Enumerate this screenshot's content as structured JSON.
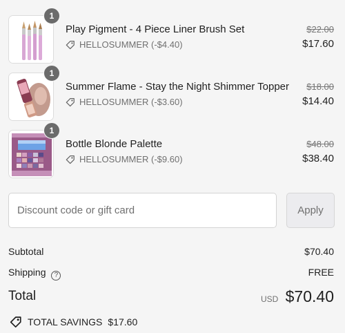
{
  "items": [
    {
      "quantity": "1",
      "name": "Play Pigment - 4 Piece Liner Brush Set",
      "discount": "HELLOSUMMER (-$4.40)",
      "original_price": "$22.00",
      "price": "$17.60"
    },
    {
      "quantity": "1",
      "name": "Summer Flame - Stay the Night Shimmer Topper",
      "discount": "HELLOSUMMER (-$3.60)",
      "original_price": "$18.00",
      "price": "$14.40"
    },
    {
      "quantity": "1",
      "name": "Bottle Blonde Palette",
      "discount": "HELLOSUMMER (-$9.60)",
      "original_price": "$48.00",
      "price": "$38.40"
    }
  ],
  "discount_form": {
    "placeholder": "Discount code or gift card",
    "value": "",
    "apply_label": "Apply"
  },
  "summary": {
    "subtotal_label": "Subtotal",
    "subtotal_value": "$70.40",
    "shipping_label": "Shipping",
    "shipping_value": "FREE",
    "help_glyph": "?",
    "total_label": "Total",
    "currency": "USD",
    "total_value": "$70.40",
    "savings_label": "TOTAL SAVINGS",
    "savings_value": "$17.60"
  },
  "icons": {
    "item_discount": "tag-icon",
    "shipping_help": "help-circle-icon",
    "savings": "tag-icon"
  },
  "colors": {
    "background": "#f5f5f5",
    "quantity_badge": "#6b6b6b",
    "muted_text": "#707070",
    "apply_button_bg": "#ececef"
  }
}
